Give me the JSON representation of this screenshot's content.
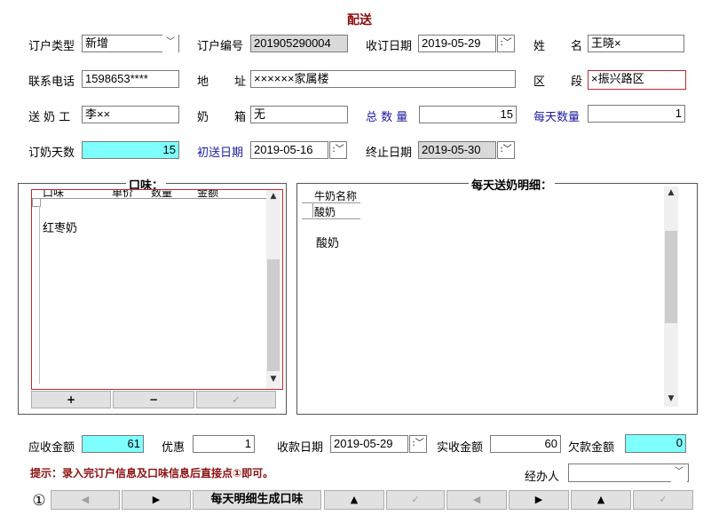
{
  "title": "配送",
  "row1": {
    "order_type_label": "订户类型",
    "order_type_value": "新增",
    "order_no_label": "订户编号",
    "order_no_value": "201905290004",
    "order_date_label": "收订日期",
    "order_date_value": "2019-05-29",
    "surname_label": "姓",
    "name_label": "名",
    "name_value": "王晓×"
  },
  "row2": {
    "phone_label": "联系电话",
    "phone_value": "1598653****",
    "addr_label1": "地",
    "addr_label2": "址",
    "addr_value": "××××××家属楼",
    "district_label1": "区",
    "district_label2": "段",
    "district_value": "×振兴路区"
  },
  "row3": {
    "worker_label": "送 奶 工",
    "worker_value": "李××",
    "box_label1": "奶",
    "box_label2": "箱",
    "box_value": "无",
    "total_label": "总 数 量",
    "total_value": "15",
    "daily_label": "每天数量",
    "daily_value": "1"
  },
  "row4": {
    "days_label": "订奶天数",
    "days_value": "15",
    "start_label": "初送日期",
    "start_value": "2019-05-16",
    "end_label": "终止日期",
    "end_value": "2019-05-30"
  },
  "flavor": {
    "title": "口味：",
    "headers": [
      "口味",
      "单价",
      "数量",
      "金额"
    ],
    "rows": [
      "红枣奶"
    ],
    "add": "+",
    "remove": "−",
    "confirm": "✓"
  },
  "daily": {
    "title": "每天送奶明细：",
    "header": "牛奶名称",
    "header_row": "酸奶",
    "rows": [
      "酸奶"
    ]
  },
  "bottom": {
    "receivable_label": "应收金额",
    "receivable_value": "61",
    "discount_label": "优惠",
    "discount_value": "1",
    "paydate_label": "收款日期",
    "paydate_value": "2019-05-29",
    "paid_label": "实收金额",
    "paid_value": "60",
    "owed_label": "欠款金额",
    "owed_value": "0",
    "hint": "提示：录入完订户信息及口味信息后直接点①即可。",
    "handler_label": "经办人",
    "handler_value": ""
  },
  "nav": {
    "circle": "①",
    "prev": "◀",
    "next": "▶",
    "generate": "每天明细生成口味",
    "up": "▲",
    "check": "✓"
  },
  "icons": {
    "dropdown": "chevron-down-icon",
    "spin": "spinner-icon",
    "check": "check-icon"
  },
  "colors": {
    "title": "#8b1010",
    "highlight": "#80ffff",
    "required": "#c0282c",
    "blue_label": "#1a1aa0"
  }
}
